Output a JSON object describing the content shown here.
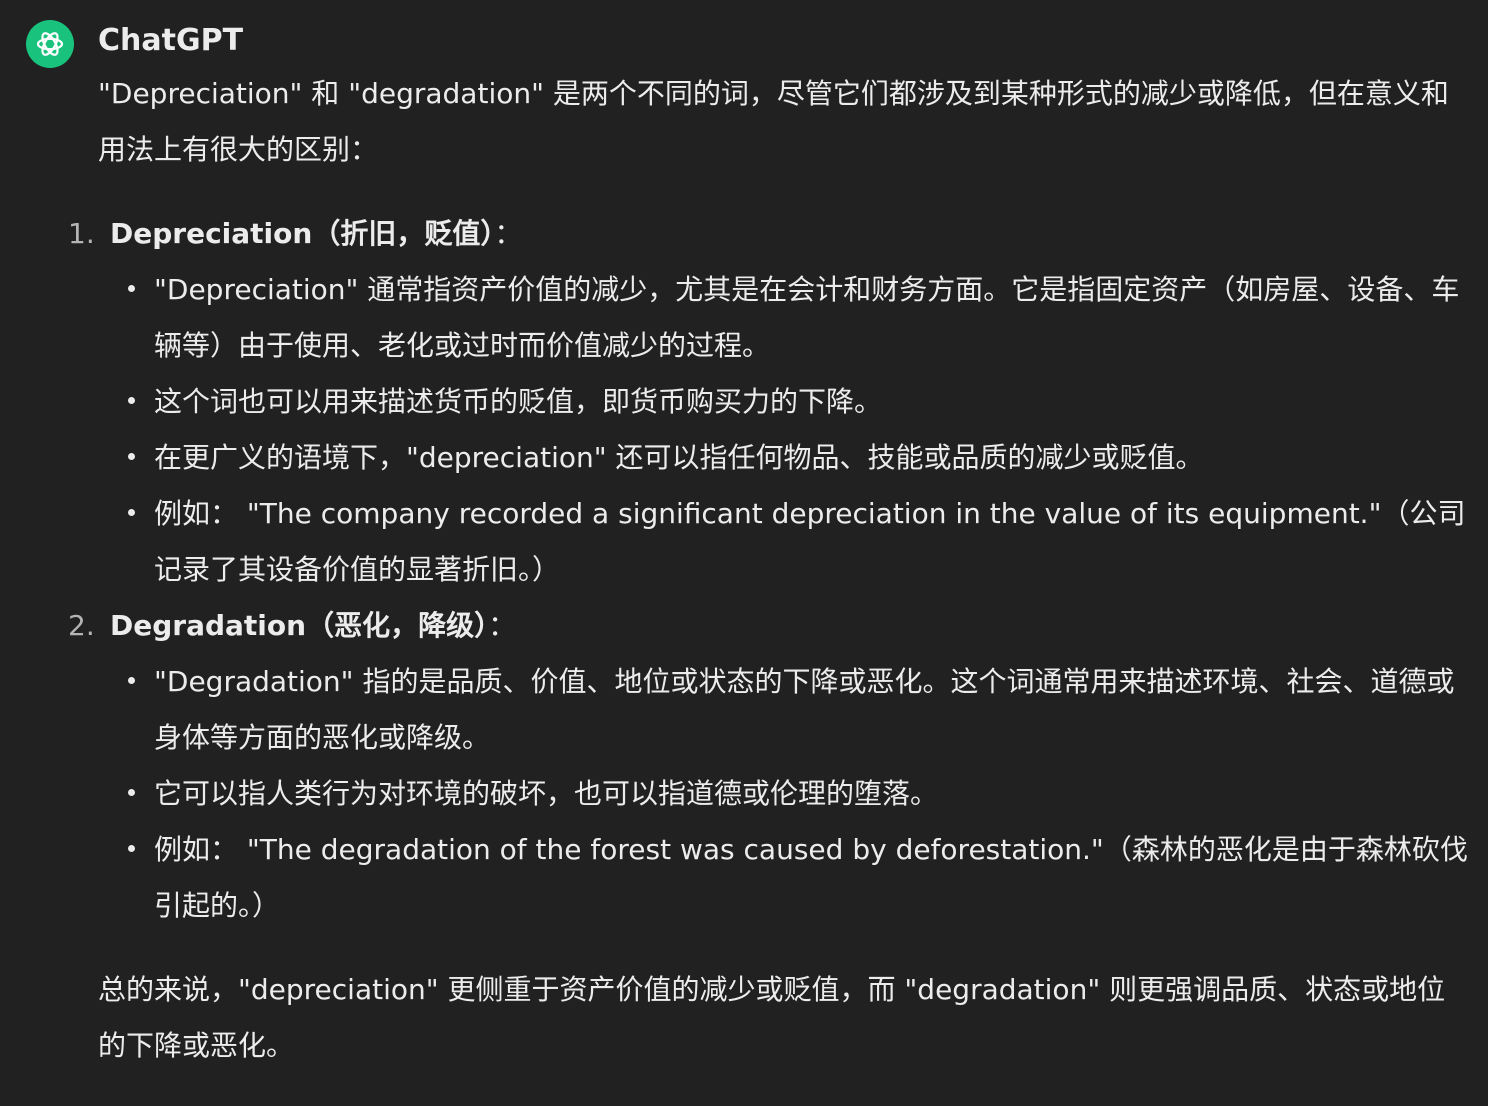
{
  "author": "ChatGPT",
  "colors": {
    "background": "#212121",
    "text": "#ececec",
    "avatar": "#19c37d"
  },
  "message": {
    "intro": "\"Depreciation\" 和 \"degradation\" 是两个不同的词，尽管它们都涉及到某种形式的减少或降低，但在意义和用法上有很大的区别：",
    "sections": [
      {
        "number": "1.",
        "heading": "Depreciation（折旧，贬值）",
        "suffix": "：",
        "bullets": [
          "\"Depreciation\" 通常指资产价值的减少，尤其是在会计和财务方面。它是指固定资产（如房屋、设备、车辆等）由于使用、老化或过时而价值减少的过程。",
          "这个词也可以用来描述货币的贬值，即货币购买力的下降。",
          "在更广义的语境下，\"depreciation\" 还可以指任何物品、技能或品质的减少或贬值。",
          "例如： \"The company recorded a significant depreciation in the value of its equipment.\"（公司记录了其设备价值的显著折旧。）"
        ]
      },
      {
        "number": "2.",
        "heading": "Degradation（恶化，降级）",
        "suffix": "：",
        "bullets": [
          "\"Degradation\" 指的是品质、价值、地位或状态的下降或恶化。这个词通常用来描述环境、社会、道德或身体等方面的恶化或降级。",
          "它可以指人类行为对环境的破坏，也可以指道德或伦理的堕落。",
          "例如： \"The degradation of the forest was caused by deforestation.\"（森林的恶化是由于森林砍伐引起的。）"
        ]
      }
    ],
    "summary": "总的来说，\"depreciation\" 更侧重于资产价值的减少或贬值，而 \"degradation\" 则更强调品质、状态或地位的下降或恶化。"
  }
}
